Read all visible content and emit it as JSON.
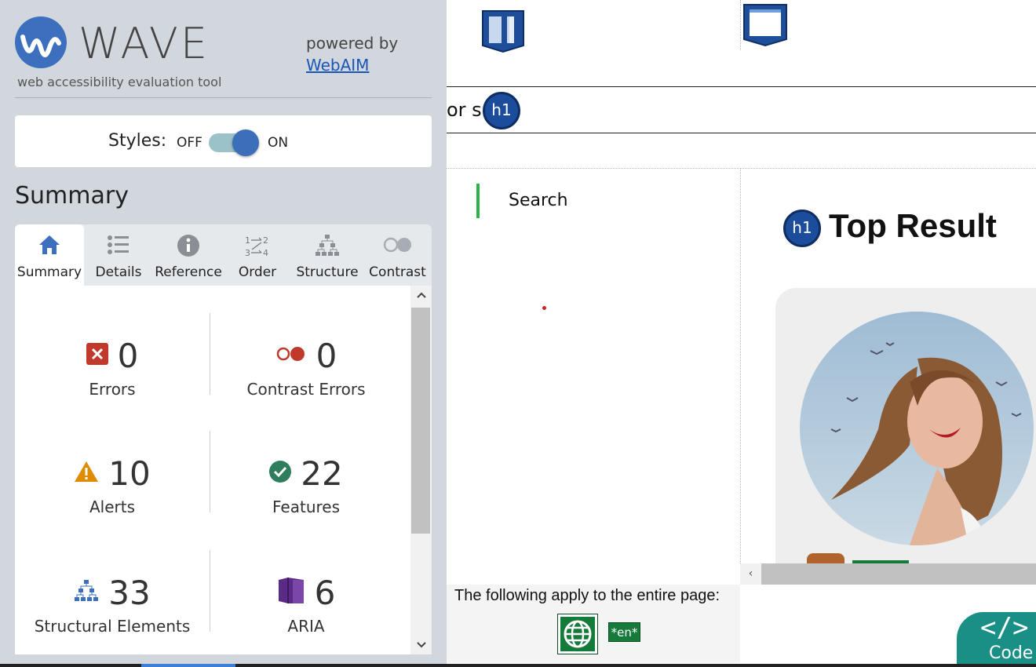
{
  "wave": {
    "logo_text": "WAVE",
    "subtitle": "web accessibility evaluation tool",
    "powered_by": "powered by",
    "webaim_link": "WebAIM"
  },
  "styles": {
    "label": "Styles:",
    "off": "OFF",
    "on": "ON",
    "state": "ON"
  },
  "summary": {
    "heading": "Summary",
    "tabs": [
      {
        "label": "Summary",
        "icon": "home-icon",
        "active": true
      },
      {
        "label": "Details",
        "icon": "list-icon"
      },
      {
        "label": "Reference",
        "icon": "info-icon"
      },
      {
        "label": "Order",
        "icon": "order-icon"
      },
      {
        "label": "Structure",
        "icon": "structure-icon"
      },
      {
        "label": "Contrast",
        "icon": "contrast-icon"
      }
    ],
    "stats": {
      "errors": {
        "count": "0",
        "label": "Errors",
        "color": "#c0392b"
      },
      "contrast": {
        "count": "0",
        "label": "Contrast Errors",
        "color": "#c0392b"
      },
      "alerts": {
        "count": "10",
        "label": "Alerts",
        "color": "#e08a00"
      },
      "features": {
        "count": "22",
        "label": "Features",
        "color": "#2e7d5b"
      },
      "structural": {
        "count": "33",
        "label": "Structural Elements",
        "color": "#3c6fbd"
      },
      "aria": {
        "count": "6",
        "label": "ARIA",
        "color": "#5b2a86"
      }
    }
  },
  "page": {
    "h1_label": "h1",
    "partial_text": "or s",
    "search": "Search",
    "top_result": "Top Result",
    "entire_page": "The following apply to the entire page:",
    "lang": "*en*",
    "code_label": "Code",
    "code_glyph": "</>",
    "scroll_left": "‹"
  },
  "scroll": {
    "up": "^",
    "down": "v"
  }
}
